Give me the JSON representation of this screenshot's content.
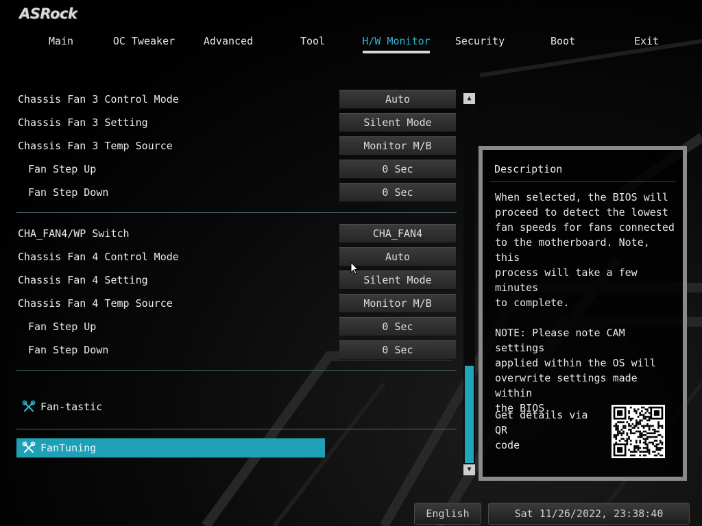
{
  "brand": {
    "logo": "ASRock"
  },
  "nav": {
    "tabs": [
      {
        "label": "Main"
      },
      {
        "label": "OC Tweaker"
      },
      {
        "label": "Advanced"
      },
      {
        "label": "Tool"
      },
      {
        "label": "H/W Monitor",
        "active": true
      },
      {
        "label": "Security"
      },
      {
        "label": "Boot"
      },
      {
        "label": "Exit"
      }
    ]
  },
  "settings": [
    {
      "label": "Chassis Fan 3 Control Mode",
      "value": "Auto"
    },
    {
      "label": "Chassis Fan 3 Setting",
      "value": "Silent Mode"
    },
    {
      "label": "Chassis Fan 3 Temp Source",
      "value": "Monitor M/B"
    },
    {
      "label": "Fan Step Up",
      "value": "0 Sec"
    },
    {
      "label": "Fan Step Down",
      "value": "0 Sec"
    },
    {
      "label": "CHA_FAN4/WP Switch",
      "value": "CHA_FAN4"
    },
    {
      "label": "Chassis Fan 4 Control Mode",
      "value": "Auto"
    },
    {
      "label": "Chassis Fan 4 Setting",
      "value": "Silent Mode"
    },
    {
      "label": "Chassis Fan 4 Temp Source",
      "value": "Monitor M/B"
    },
    {
      "label": "Fan Step Up",
      "value": "0 Sec"
    },
    {
      "label": "Fan Step Down",
      "value": "0 Sec"
    }
  ],
  "tools": [
    {
      "label": "Fan-tastic"
    },
    {
      "label": "FanTuning",
      "selected": true
    }
  ],
  "description": {
    "title": "Description",
    "body": "When selected, the BIOS will\nproceed to detect the lowest\nfan speeds for fans connected\nto the motherboard. Note, this\nprocess will take a few minutes\nto complete.\n\nNOTE: Please note CAM settings\napplied within the OS will\noverwrite settings made within\nthe BIOS.",
    "qr_text": "Get details via QR\ncode"
  },
  "footer": {
    "language": "English",
    "datetime": "Sat 11/26/2022, 23:38:40"
  },
  "colors": {
    "accent": "#1ea1b6",
    "active_tab": "#2fb7d0",
    "background": "#000000"
  }
}
